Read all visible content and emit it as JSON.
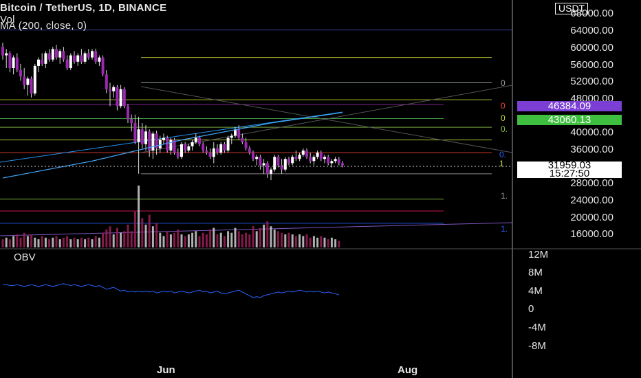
{
  "header": {
    "title": "Bitcoin / TetherUS, 1D, BINANCE",
    "volume_label": "Vol",
    "ma_label": "MA (200, close, 0)"
  },
  "currency": "USDT",
  "obv_label": "OBV",
  "price_axis_ticks": [
    "68000.00",
    "64000.00",
    "60000.00",
    "56000.00",
    "52000.00",
    "48000.00",
    "40000.00",
    "36000.00",
    "28000.00",
    "24000.00",
    "20000.00",
    "16000.00"
  ],
  "obv_axis_ticks": [
    "12M",
    "8M",
    "4M",
    "0",
    "-4M",
    "-8M"
  ],
  "badges": {
    "purple": "46384.09",
    "green": "43060.13"
  },
  "current_price": {
    "price": "31959.03",
    "countdown": "15:27:50"
  },
  "x_axis_labels": [
    "Jun",
    "Aug"
  ],
  "fib_labels": [
    "0",
    "0",
    "0",
    "0.",
    "0.",
    "1",
    "1.",
    "1."
  ],
  "colors": {
    "bullish": "#ffffff",
    "bearish": "#9c27b0",
    "badge_purple": "#7b3fd6",
    "badge_green": "#3fbf3f",
    "obv_line": "#2962ff"
  },
  "chart_data": {
    "type": "candlestick",
    "symbol": "Bitcoin / TetherUS",
    "interval": "1D",
    "exchange": "BINANCE",
    "ylim": [
      13000,
      70000
    ],
    "x_ticks": [
      "Jun",
      "Aug"
    ],
    "candles": [
      [
        60000,
        61000,
        57000,
        58000
      ],
      [
        58000,
        59500,
        55000,
        58500
      ],
      [
        58500,
        59000,
        54000,
        55000
      ],
      [
        55000,
        58000,
        53500,
        57500
      ],
      [
        57500,
        58500,
        54000,
        54500
      ],
      [
        54500,
        56000,
        52000,
        53000
      ],
      [
        53000,
        55000,
        50000,
        51000
      ],
      [
        51000,
        53000,
        48500,
        52500
      ],
      [
        52500,
        53000,
        48000,
        49000
      ],
      [
        49000,
        56000,
        48500,
        55500
      ],
      [
        55500,
        57500,
        54000,
        57000
      ],
      [
        57000,
        58500,
        55500,
        56000
      ],
      [
        56000,
        59000,
        55000,
        58500
      ],
      [
        58500,
        59500,
        56500,
        57000
      ],
      [
        57000,
        60000,
        56500,
        59500
      ],
      [
        59500,
        60500,
        57000,
        57500
      ],
      [
        57500,
        59500,
        56000,
        59000
      ],
      [
        59000,
        60000,
        56500,
        57000
      ],
      [
        57000,
        58000,
        54500,
        55000
      ],
      [
        55000,
        58500,
        54500,
        58000
      ],
      [
        58000,
        59000,
        56000,
        56500
      ],
      [
        56500,
        58500,
        55500,
        58000
      ],
      [
        58000,
        59500,
        56000,
        56500
      ],
      [
        56500,
        59000,
        56000,
        58500
      ],
      [
        58500,
        59500,
        57000,
        57500
      ],
      [
        57500,
        59500,
        57000,
        59000
      ],
      [
        59000,
        59600,
        56000,
        56500
      ],
      [
        56500,
        58000,
        55500,
        57500
      ],
      [
        57500,
        58000,
        53000,
        53500
      ],
      [
        53500,
        54500,
        49000,
        50000
      ],
      [
        50000,
        51500,
        46000,
        49500
      ],
      [
        49500,
        51000,
        48000,
        50500
      ],
      [
        50500,
        51000,
        45000,
        46000
      ],
      [
        46000,
        51000,
        45500,
        50000
      ],
      [
        50000,
        50500,
        45500,
        46000
      ],
      [
        46000,
        46500,
        42000,
        43000
      ],
      [
        43000,
        44000,
        40000,
        42000
      ],
      [
        42000,
        44000,
        37000,
        37500
      ],
      [
        37500,
        43500,
        30000,
        40500
      ],
      [
        40500,
        42000,
        36000,
        37000
      ],
      [
        37000,
        41500,
        35500,
        40000
      ],
      [
        40000,
        40500,
        34000,
        35500
      ],
      [
        35500,
        40000,
        33500,
        39500
      ],
      [
        39500,
        40200,
        34500,
        36000
      ],
      [
        36000,
        39000,
        35000,
        38000
      ],
      [
        38000,
        39500,
        37000,
        38500
      ],
      [
        38500,
        39000,
        35000,
        35500
      ],
      [
        35500,
        38500,
        34500,
        38000
      ],
      [
        38000,
        38500,
        34500,
        35000
      ],
      [
        35000,
        36000,
        33500,
        34000
      ],
      [
        34000,
        37500,
        33500,
        37000
      ],
      [
        37000,
        37500,
        35000,
        35500
      ],
      [
        35500,
        37000,
        35000,
        36500
      ],
      [
        36500,
        38000,
        35500,
        37500
      ],
      [
        37500,
        39500,
        37000,
        38500
      ],
      [
        38500,
        39000,
        36500,
        37000
      ],
      [
        37000,
        37500,
        35000,
        35500
      ],
      [
        35500,
        36500,
        34500,
        35000
      ],
      [
        35000,
        36000,
        33500,
        34000
      ],
      [
        34000,
        37500,
        32500,
        36000
      ],
      [
        36000,
        37000,
        34500,
        35000
      ],
      [
        35000,
        37500,
        34500,
        37000
      ],
      [
        37000,
        37500,
        35000,
        35500
      ],
      [
        35500,
        39000,
        35000,
        38500
      ],
      [
        38500,
        39500,
        37000,
        39000
      ],
      [
        39000,
        41000,
        38500,
        40500
      ],
      [
        40500,
        41500,
        38000,
        38500
      ],
      [
        38500,
        39500,
        37000,
        37500
      ],
      [
        37500,
        38500,
        35500,
        36000
      ],
      [
        36000,
        36500,
        34500,
        35000
      ],
      [
        35000,
        35500,
        33000,
        33500
      ],
      [
        33500,
        34500,
        32000,
        34000
      ],
      [
        34000,
        34500,
        31000,
        32000
      ],
      [
        32000,
        33500,
        30000,
        32500
      ],
      [
        32500,
        33000,
        29000,
        30000
      ],
      [
        30000,
        31500,
        28500,
        31000
      ],
      [
        31000,
        34500,
        30500,
        34000
      ],
      [
        34000,
        34500,
        31500,
        32000
      ],
      [
        32000,
        33500,
        30000,
        31000
      ],
      [
        31000,
        34000,
        30500,
        33500
      ],
      [
        33500,
        34000,
        32000,
        32500
      ],
      [
        32500,
        34500,
        32000,
        34000
      ],
      [
        34000,
        35500,
        33000,
        33500
      ],
      [
        33500,
        35000,
        33000,
        34500
      ],
      [
        34500,
        36000,
        34000,
        35500
      ],
      [
        35500,
        36000,
        33500,
        34000
      ],
      [
        34000,
        35000,
        32500,
        33000
      ],
      [
        33000,
        34500,
        32000,
        34000
      ],
      [
        34000,
        35500,
        33500,
        35000
      ],
      [
        35000,
        35500,
        33000,
        33500
      ],
      [
        33500,
        34500,
        32500,
        34000
      ],
      [
        34000,
        34500,
        32000,
        32500
      ],
      [
        32500,
        33500,
        31500,
        33000
      ],
      [
        33000,
        34000,
        32500,
        33500
      ],
      [
        33500,
        34000,
        32000,
        32500
      ],
      [
        32500,
        33000,
        31500,
        32000
      ]
    ],
    "volume": [
      5,
      6,
      5,
      7,
      8,
      6,
      9,
      7,
      8,
      6,
      5,
      7,
      6,
      5,
      6,
      7,
      5,
      6,
      7,
      5,
      6,
      5,
      6,
      5,
      6,
      5,
      7,
      6,
      9,
      11,
      13,
      8,
      12,
      9,
      10,
      14,
      10,
      22,
      38,
      18,
      14,
      20,
      13,
      15,
      9,
      7,
      10,
      8,
      9,
      11,
      8,
      7,
      8,
      9,
      10,
      7,
      9,
      8,
      11,
      12,
      8,
      9,
      7,
      10,
      9,
      12,
      10,
      8,
      9,
      8,
      13,
      10,
      12,
      14,
      16,
      13,
      11,
      10,
      9,
      8,
      9,
      8,
      7,
      8,
      7,
      8,
      6,
      7,
      6,
      7,
      6,
      5,
      6,
      5,
      4
    ],
    "moving_average": {
      "label": "MA (200, close, 0)",
      "points": [
        [
          0,
          29000
        ],
        [
          25,
          33000
        ],
        [
          50,
          38000
        ],
        [
          75,
          42000
        ],
        [
          95,
          44500
        ]
      ]
    },
    "horizontal_levels": [
      64000,
      57500,
      51500,
      47500,
      46384.09,
      43060.13,
      41000,
      38000,
      35000,
      30000,
      24000,
      21200,
      18300
    ],
    "obv": {
      "ylim": [
        -10,
        13
      ],
      "values": [
        2.6,
        2.6,
        2.5,
        2.5,
        2.6,
        2.5,
        2.4,
        2.5,
        2.6,
        2.5,
        2.4,
        2.5,
        2.6,
        2.5,
        2.4,
        2.5,
        2.6,
        2.7,
        2.6,
        2.5,
        2.6,
        2.5,
        2.4,
        2.5,
        2.6,
        2.5,
        2.4,
        2.5,
        2.3,
        2.1,
        2.2,
        2.3,
        2.1,
        1.9,
        2.0,
        1.8,
        1.9,
        1.8,
        1.9,
        1.8,
        1.9,
        1.8,
        1.9,
        1.7,
        1.8,
        1.9,
        1.8,
        1.9,
        1.7,
        1.8,
        1.9,
        1.8,
        1.7,
        1.8,
        1.9,
        2.0,
        1.8,
        1.9,
        1.7,
        1.8,
        1.9,
        1.7,
        1.6,
        1.7,
        1.8,
        1.9,
        2.0,
        1.8,
        1.6,
        1.4,
        1.2,
        1.3,
        1.2,
        1.4,
        1.5,
        1.6,
        1.7,
        1.8,
        1.7,
        1.8,
        1.9,
        1.8,
        1.9,
        2.0,
        1.9,
        1.8,
        1.9,
        1.8,
        1.9,
        1.8,
        1.7,
        1.8,
        1.7,
        1.6,
        1.5
      ]
    }
  }
}
